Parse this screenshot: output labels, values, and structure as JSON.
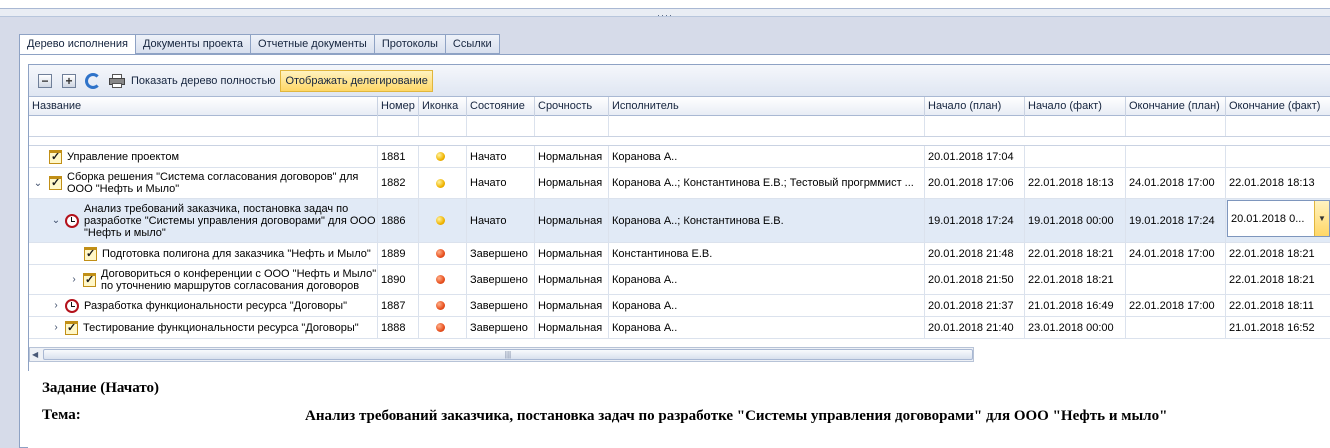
{
  "tabs": [
    {
      "label": "Дерево исполнения",
      "active": true
    },
    {
      "label": "Документы проекта",
      "active": false
    },
    {
      "label": "Отчетные документы",
      "active": false
    },
    {
      "label": "Протоколы",
      "active": false
    },
    {
      "label": "Ссылки",
      "active": false
    }
  ],
  "toolbar": {
    "collapse_icon": "minus-box-icon",
    "expand_icon": "plus-box-icon",
    "refresh_icon": "refresh-icon",
    "print_icon": "printer-icon",
    "show_full_tree_label": "Показать дерево полностью",
    "show_delegation_label": "Отображать делегирование"
  },
  "columns": {
    "name": "Название",
    "number": "Номер",
    "icon": "Иконка",
    "state": "Состояние",
    "urgency": "Срочность",
    "executor": "Исполнитель",
    "start_plan": "Начало (план)",
    "start_fact": "Начало (факт)",
    "end_plan": "Окончание (план)",
    "end_fact": "Окончание (факт)"
  },
  "rows": [
    {
      "name": "Управление проектом",
      "expander": "",
      "type": "task",
      "number": "1881",
      "status_color": "yellow",
      "state": "Начато",
      "urgency": "Нормальная",
      "executor": "Коранова А..",
      "start_plan": "20.01.2018 17:04",
      "start_fact": "",
      "end_plan": "",
      "end_fact": ""
    },
    {
      "name": "Сборка решения \"Система согласования договоров\" для ООО \"Нефть и Мыло\"",
      "expander": "⌄",
      "type": "task",
      "number": "1882",
      "status_color": "yellow",
      "state": "Начато",
      "urgency": "Нормальная",
      "executor": "Коранова А..; Константинова Е.В.; Тестовый прогрммист ...",
      "start_plan": "20.01.2018 17:06",
      "start_fact": "22.01.2018 18:13",
      "end_plan": "24.01.2018 17:00",
      "end_fact": "22.01.2018 18:13"
    },
    {
      "name": "Анализ требований заказчика, постановка задач по разработке \"Системы управления договорами\" для ООО \"Нефть и мыло\"",
      "expander": "⌄",
      "type": "clock",
      "number": "1886",
      "status_color": "yellow",
      "state": "Начато",
      "urgency": "Нормальная",
      "executor": "Коранова А..; Константинова Е.В.",
      "start_plan": "19.01.2018 17:24",
      "start_fact": "19.01.2018 00:00",
      "end_plan": "19.01.2018 17:24",
      "end_fact": "20.01.2018 0..."
    },
    {
      "name": "Подготовка полигона для заказчика \"Нефть и Мыло\"",
      "expander": "",
      "type": "task",
      "number": "1889",
      "status_color": "red",
      "state": "Завершено",
      "urgency": "Нормальная",
      "executor": "Константинова Е.В.",
      "start_plan": "20.01.2018 21:48",
      "start_fact": "22.01.2018 18:21",
      "end_plan": "24.01.2018 17:00",
      "end_fact": "22.01.2018 18:21"
    },
    {
      "name": "Договориться о конференции с ООО \"Нефть и Мыло\" по уточнению  маршрутов согласования договоров",
      "expander": "›",
      "type": "task",
      "number": "1890",
      "status_color": "red",
      "state": "Завершено",
      "urgency": "Нормальная",
      "executor": "Коранова А..",
      "start_plan": "20.01.2018 21:50",
      "start_fact": "22.01.2018 18:21",
      "end_plan": "",
      "end_fact": "22.01.2018 18:21"
    },
    {
      "name": "Разработка функциональности ресурса \"Договоры\"",
      "expander": "›",
      "type": "clock",
      "number": "1887",
      "status_color": "red",
      "state": "Завершено",
      "urgency": "Нормальная",
      "executor": "Коранова А..",
      "start_plan": "20.01.2018 21:37",
      "start_fact": "21.01.2018 16:49",
      "end_plan": "22.01.2018 17:00",
      "end_fact": "22.01.2018 18:11"
    },
    {
      "name": "Тестирование функциональности ресурса \"Договоры\"",
      "expander": "›",
      "type": "task",
      "number": "1888",
      "status_color": "red",
      "state": "Завершено",
      "urgency": "Нормальная",
      "executor": "Коранова А..",
      "start_plan": "20.01.2018 21:40",
      "start_fact": "23.01.2018 00:00",
      "end_plan": "",
      "end_fact": "21.01.2018 16:52"
    }
  ],
  "details": {
    "title": "Задание (Начато)",
    "topic_label": "Тема:",
    "topic_value": "Анализ требований заказчика, постановка задач по разработке \"Системы управления договорами\" для ООО \"Нефть и мыло\""
  }
}
